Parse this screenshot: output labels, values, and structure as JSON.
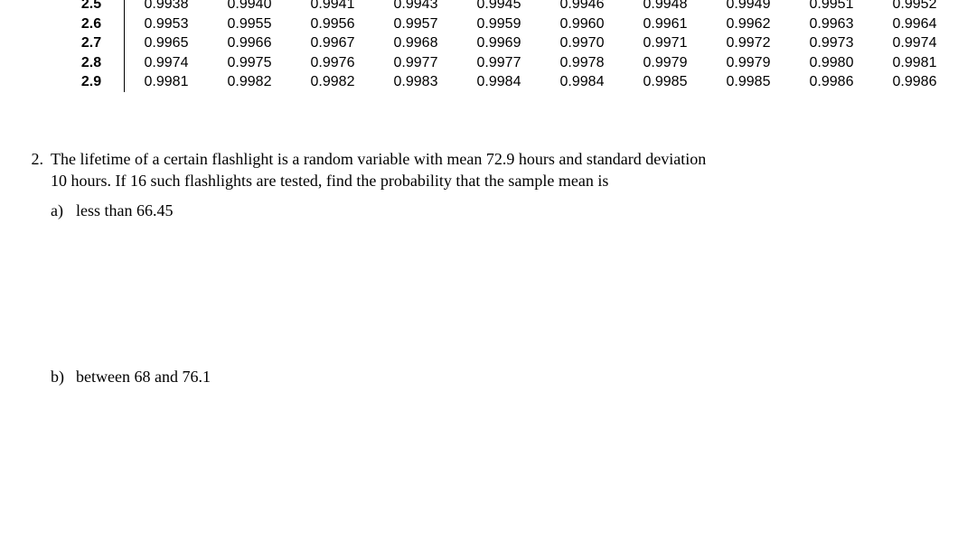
{
  "table": {
    "rows": [
      {
        "head": "2.5",
        "vals": [
          "0.9938",
          "0.9940",
          "0.9941",
          "0.9943",
          "0.9945",
          "0.9946",
          "0.9948",
          "0.9949",
          "0.9951",
          "0.9952"
        ]
      },
      {
        "head": "2.6",
        "vals": [
          "0.9953",
          "0.9955",
          "0.9956",
          "0.9957",
          "0.9959",
          "0.9960",
          "0.9961",
          "0.9962",
          "0.9963",
          "0.9964"
        ]
      },
      {
        "head": "2.7",
        "vals": [
          "0.9965",
          "0.9966",
          "0.9967",
          "0.9968",
          "0.9969",
          "0.9970",
          "0.9971",
          "0.9972",
          "0.9973",
          "0.9974"
        ]
      },
      {
        "head": "2.8",
        "vals": [
          "0.9974",
          "0.9975",
          "0.9976",
          "0.9977",
          "0.9977",
          "0.9978",
          "0.9979",
          "0.9979",
          "0.9980",
          "0.9981"
        ]
      },
      {
        "head": "2.9",
        "vals": [
          "0.9981",
          "0.9982",
          "0.9982",
          "0.9983",
          "0.9984",
          "0.9984",
          "0.9985",
          "0.9985",
          "0.9986",
          "0.9986"
        ]
      }
    ]
  },
  "problem": {
    "number": "2.",
    "text_line1": "The lifetime of a certain flashlight is a random variable with mean 72.9 hours and standard deviation",
    "text_line2": "10 hours. If 16 such flashlights are tested, find the probability that the sample mean is",
    "parts": {
      "a": {
        "label": "a)",
        "text": "less than 66.45"
      },
      "b": {
        "label": "b)",
        "text": "between 68 and 76.1"
      }
    }
  }
}
